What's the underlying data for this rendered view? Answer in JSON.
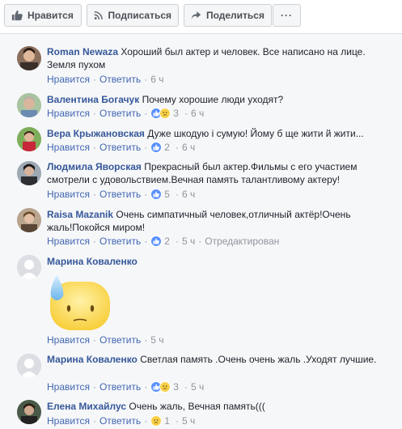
{
  "actions": {
    "like": "Нравится",
    "subscribe": "Подписаться",
    "share": "Поделиться",
    "more": "···"
  },
  "labels": {
    "like": "Нравится",
    "reply": "Ответить",
    "dot": "·",
    "edited": "Отредактирован"
  },
  "comments": [
    {
      "author": "Roman Newaza",
      "text": "Хороший был актер и человек. Все написано на лице. Земля пухом",
      "time": "6 ч"
    },
    {
      "author": "Валентина Богачук",
      "text": "Почему хорошие люди уходят?",
      "reactions": "3",
      "time": "6 ч"
    },
    {
      "author": "Вера Крыжановская",
      "text": "Дуже шкодую і сумую! Йому б ще жити й жити...",
      "reactions": "2",
      "time": "6 ч"
    },
    {
      "author": "Людмила Яворская",
      "text": "Прекрасный был актер.Фильмы с его участием смотрели с удовольствием.Вечная память талантливому актеру!",
      "reactions": "5",
      "time": "6 ч"
    },
    {
      "author": "Raisa Mazanik",
      "text": "Очень симпатичный человек,отличный актёр!Очень жаль!Покойся миром!",
      "reactions": "2",
      "time": "5 ч"
    },
    {
      "author": "Марина Коваленко",
      "text": "",
      "time": "5 ч"
    },
    {
      "author": "Марина Коваленко",
      "text": "Светлая память .Очень очень жаль .Уходят лучшие.",
      "reactions": "3",
      "time": "5 ч"
    },
    {
      "author": "Елена Михайлус",
      "text": "Очень жаль, Вечная память(((",
      "reactions": "1",
      "time": "5 ч"
    }
  ],
  "colors": {
    "link": "#365899",
    "action": "#4267b2",
    "meta": "#90949c",
    "panel": "#f6f7f9"
  }
}
